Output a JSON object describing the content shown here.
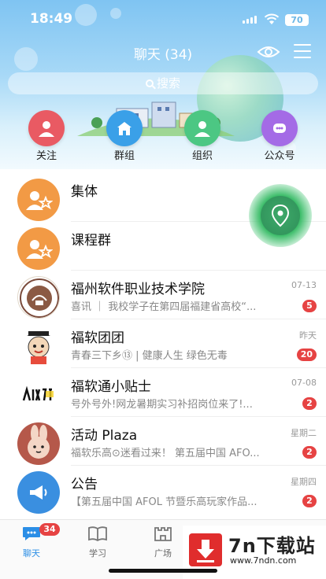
{
  "status_bar": {
    "time": "18:49",
    "battery": "70"
  },
  "header": {
    "title": "聊天 (34)",
    "search_placeholder": "搜索"
  },
  "shortcuts": [
    {
      "label": "关注",
      "icon": "person-icon",
      "color": "#e95a63"
    },
    {
      "label": "群组",
      "icon": "building-icon",
      "color": "#3aa0e8"
    },
    {
      "label": "组织",
      "icon": "person-icon",
      "color": "#4cc783"
    },
    {
      "label": "公众号",
      "icon": "broadcast-icon",
      "color": "#a46be6"
    }
  ],
  "conversations": [
    {
      "name": "集体",
      "preview": "",
      "time": "",
      "badge": ""
    },
    {
      "name": "课程群",
      "preview": "",
      "time": "",
      "badge": ""
    },
    {
      "name": "福州软件职业技术学院",
      "preview": "喜讯 ｜ 我校学子在第四届福建省高校“...",
      "time": "07-13",
      "badge": "5"
    },
    {
      "name": "福软团团",
      "preview": "青春三下乡⑬ | 健康人生 绿色无毒",
      "time": "昨天",
      "badge": "20"
    },
    {
      "name": "福软通小贴士",
      "preview": "号外号外!网龙暑期实习补招岗位来了!...",
      "time": "07-08",
      "badge": "2"
    },
    {
      "name": "活动 Plaza",
      "preview": "福软乐高⊙迷看过来！ 第五届中国 AFO...",
      "time": "星期二",
      "badge": "2"
    },
    {
      "name": "公告",
      "preview": "【第五届中国 AFOL 节暨乐高玩家作品...",
      "time": "星期四",
      "badge": "2"
    }
  ],
  "tabbar": {
    "tabs": [
      {
        "label": "聊天",
        "icon": "chat-icon"
      },
      {
        "label": "学习",
        "icon": "book-icon"
      },
      {
        "label": "广场",
        "icon": "castle-icon"
      }
    ],
    "chat_badge": "34"
  },
  "watermark": {
    "title": "7n下载站",
    "url": "www.7ndn.com"
  },
  "colors": {
    "accent": "#2b8ee6",
    "badge": "#e64343",
    "orange": "#f29a45"
  }
}
